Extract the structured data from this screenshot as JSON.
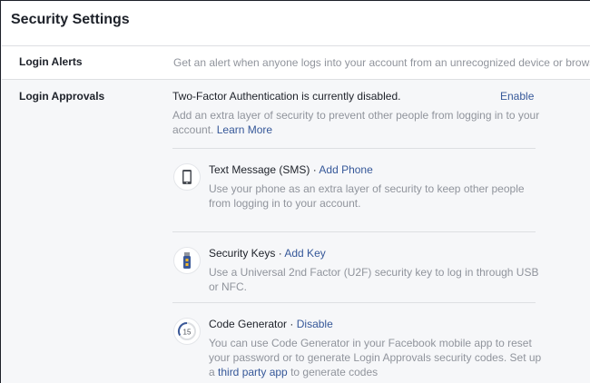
{
  "header": {
    "title": "Security Settings"
  },
  "login_alerts": {
    "label": "Login Alerts",
    "description": "Get an alert when anyone logs into your account from an unrecognized device or browser."
  },
  "login_approvals": {
    "label": "Login Approvals",
    "status": "Two-Factor Authentication is currently disabled.",
    "enable_label": "Enable",
    "intro": "Add an extra layer of security to prevent other people from logging in to your account.",
    "learn_more": "Learn More",
    "methods": [
      {
        "title": "Text Message (SMS)",
        "separator": " · ",
        "action": "Add Phone",
        "description": "Use your phone as an extra layer of security to keep other people from logging in to your account.",
        "icon": "phone-icon"
      },
      {
        "title": "Security Keys",
        "separator": " · ",
        "action": "Add Key",
        "description": "Use a Universal 2nd Factor (U2F) security key to log in through USB or NFC.",
        "icon": "usb-key-icon"
      },
      {
        "title": "Code Generator",
        "separator": " · ",
        "action": "Disable",
        "description_before": "You can use Code Generator in your Facebook mobile app to reset your password or to generate Login Approvals security codes. Set up a ",
        "description_link": "third party app",
        "description_after": " to generate codes",
        "icon": "code-generator-icon",
        "icon_text": "15"
      }
    ]
  },
  "colors": {
    "link": "#365899",
    "muted_text": "#90949c",
    "text": "#1d2129",
    "background": "#f6f7f9"
  }
}
